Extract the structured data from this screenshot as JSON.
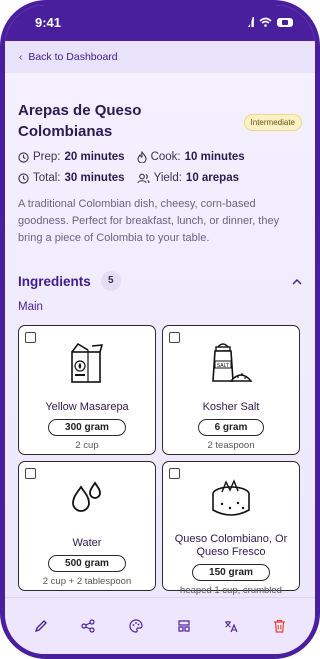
{
  "status_bar": {
    "time": "9:41"
  },
  "nav": {
    "back_label": "Back to Dashboard"
  },
  "recipe": {
    "title": "Arepas de Queso Colombianas",
    "difficulty": "Intermediate",
    "prep_label": "Prep:",
    "prep_value": "20 minutes",
    "cook_label": "Cook:",
    "cook_value": "10 minutes",
    "total_label": "Total:",
    "total_value": "30 minutes",
    "yield_label": "Yield:",
    "yield_value": "10 arepas",
    "description": "A traditional Colombian dish, cheesy, corn-based goodness. Perfect for breakfast, lunch, or dinner, they bring a piece of Colombia to your table."
  },
  "ingredients": {
    "heading": "Ingredients",
    "count": "5",
    "group": "Main",
    "items": [
      {
        "name": "Yellow Masarepa",
        "qty": "300 gram",
        "alt": "2 cup",
        "icon": "package-icon"
      },
      {
        "name": "Kosher Salt",
        "qty": "6 gram",
        "alt": "2 teaspoon",
        "icon": "salt-shaker-icon"
      },
      {
        "name": "Water",
        "qty": "500 gram",
        "alt": "2 cup + 2 tablespoon",
        "icon": "water-drops-icon"
      },
      {
        "name": "Queso Colombiano, Or Queso Fresco",
        "qty": "150 gram",
        "alt": "heaped 1 cup, crumbled",
        "icon": "cheese-icon"
      }
    ]
  },
  "toolbar": {
    "items": [
      "edit-icon",
      "share-icon",
      "palette-icon",
      "layout-icon",
      "translate-icon",
      "trash-icon"
    ]
  },
  "colors": {
    "accent": "#4a1f9e",
    "delete": "#e0443a",
    "badge_bg": "#fbf1c4"
  }
}
